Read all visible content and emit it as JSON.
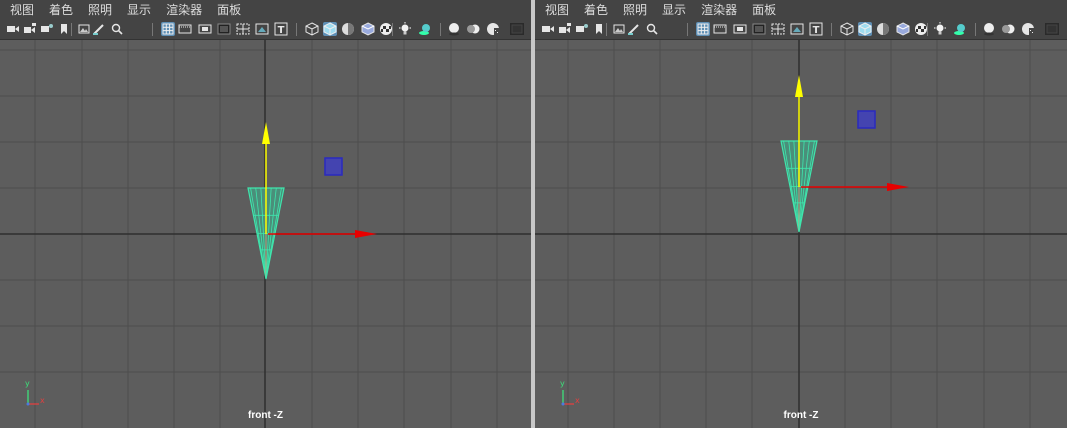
{
  "menu": [
    "视图",
    "着色",
    "照明",
    "显示",
    "渲染器",
    "面板"
  ],
  "toolbar_icons": [
    "camera-icon",
    "camera-lock-icon",
    "camera-attributes-icon",
    "bookmark-icon",
    "image-plane-icon",
    "grease-pencil-icon",
    "2d-pan-zoom-icon",
    "grid-icon",
    "film-gate-icon",
    "resolution-gate-icon",
    "gate-mask-icon",
    "field-chart-icon",
    "safe-action-icon",
    "safe-title-icon",
    "wireframe-icon",
    "smooth-shade-icon",
    "default-material-icon",
    "wireframe-on-shaded-icon",
    "textured-icon",
    "use-all-lights-icon",
    "shadows-icon",
    "screen-space-ao-icon",
    "motion-blur-icon",
    "multisample-aa-icon",
    "depth-of-field-icon"
  ],
  "viewports": [
    {
      "camera_label": "front -Z",
      "axis_x": "x",
      "axis_y": "y"
    },
    {
      "camera_label": "front -Z",
      "axis_x": "x",
      "axis_y": "y"
    }
  ],
  "colors": {
    "viewport_bg": "#5d5d5d",
    "grid": "#4d4d4d",
    "axis_line": "#2f2f2f",
    "cone": "#3fe6ad",
    "move_y": "#ffff00",
    "move_x": "#e80000",
    "box": "#2a2abf"
  }
}
